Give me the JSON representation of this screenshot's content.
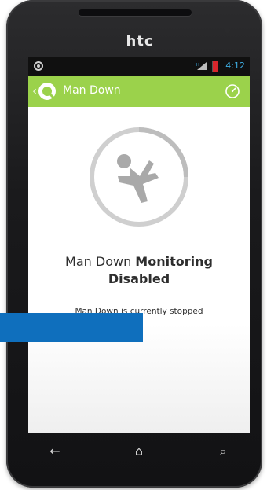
{
  "device": {
    "brand": "htc"
  },
  "status_bar": {
    "time": "4:12",
    "signal_label": "H"
  },
  "action_bar": {
    "title": "Man Down",
    "accent_color": "#9bd24b"
  },
  "content": {
    "headline_part1": "Man Down ",
    "headline_part2": "Monitoring",
    "headline_part3": "Disabled",
    "status_text": "Man Down is currently stopped",
    "main_icon": "fallen-person-icon"
  },
  "nav": {
    "back_glyph": "←",
    "home_glyph": "⌂",
    "search_glyph": "⌕"
  }
}
